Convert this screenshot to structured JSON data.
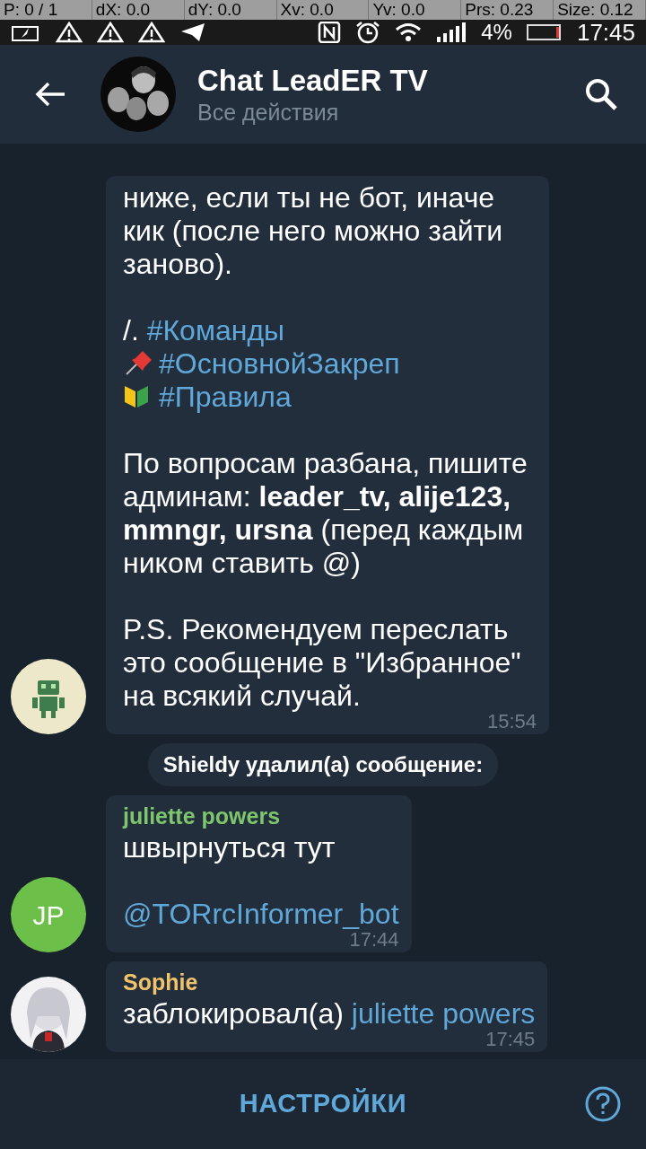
{
  "debug_overlay": [
    "P: 0 / 1",
    "dX: 0.0",
    "dY: 0.0",
    "Xv: 0.0",
    "Yv: 0.0",
    "Prs: 0.23",
    "Size: 0.12"
  ],
  "status_bar": {
    "battery": "4%",
    "time": "17:45"
  },
  "header": {
    "title": "Chat LeadER TV",
    "subtitle": "Все действия"
  },
  "messages": [
    {
      "kind": "message",
      "avatar": {
        "kind": "robot"
      },
      "time": "15:54",
      "paragraphs": [
        [
          [
            {
              "kind": "text",
              "text": "ниже, если ты не бот, иначе кик (после него можно зайти заново)."
            }
          ]
        ],
        [
          [
            {
              "kind": "text",
              "text": " /. "
            },
            {
              "kind": "link",
              "text": "#Команды"
            }
          ],
          [
            {
              "kind": "pin"
            },
            {
              "kind": "link",
              "text": "#ОсновнойЗакреп"
            }
          ],
          [
            {
              "kind": "leaf"
            },
            {
              "kind": "link",
              "text": "#Правила"
            }
          ]
        ],
        [
          [
            {
              "kind": "text",
              "text": "По вопросам разбана, пишите админам: **leader_tv, alije123, mmngr, ursna** (перед каждым ником ставить @)"
            }
          ]
        ],
        [
          [
            {
              "kind": "text",
              "text": "P.S. Рекомендуем переслать это сообщение в \"Избранное\" на всякий случай."
            }
          ]
        ]
      ]
    },
    {
      "kind": "service",
      "text": "Shieldy удалил(а) сообщение:"
    },
    {
      "kind": "message",
      "avatar": {
        "kind": "initials",
        "initials": "JP",
        "color": "#6cc04a"
      },
      "author": {
        "name": "juliette powers",
        "color": "#7ec66d"
      },
      "time": "17:44",
      "paragraphs": [
        [
          [
            {
              "kind": "text",
              "text": "швырнуться тут"
            }
          ]
        ],
        [
          [
            {
              "kind": "link",
              "text": "@TORrcInformer_bot"
            }
          ]
        ]
      ]
    },
    {
      "kind": "message",
      "avatar": {
        "kind": "picture"
      },
      "author": {
        "name": "Sophie",
        "color": "#f1c46b"
      },
      "time": "17:45",
      "paragraphs": [
        [
          [
            {
              "kind": "text",
              "text": "заблокировал(а) "
            },
            {
              "kind": "link",
              "text": "juliette powers"
            }
          ]
        ]
      ]
    }
  ],
  "bottom_bar": {
    "button": "НАСТРОЙКИ"
  }
}
